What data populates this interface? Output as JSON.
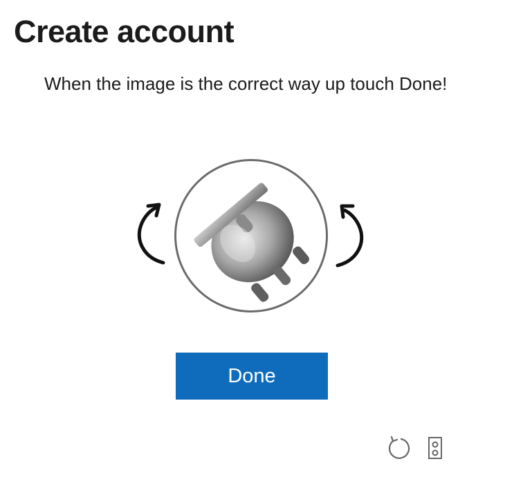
{
  "page": {
    "title": "Create account",
    "instruction": "When the image is the correct way up touch Done!"
  },
  "puzzle": {
    "rotate_left_icon": "rotate-left-arrow-icon",
    "rotate_right_icon": "rotate-right-arrow-icon",
    "image_icon": "rotated-pot-image"
  },
  "actions": {
    "done_label": "Done",
    "done_color": "#0f6cbd",
    "refresh_icon": "refresh-icon",
    "audio_icon": "audio-speaker-icon"
  }
}
